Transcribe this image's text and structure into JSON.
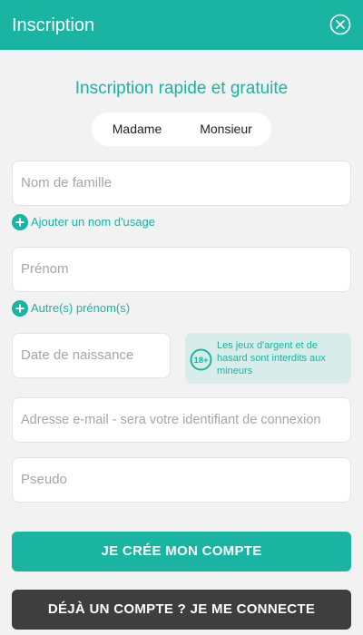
{
  "header": {
    "title": "Inscription",
    "close_icon": "close-circle-icon"
  },
  "form": {
    "subtitle": "Inscription rapide et gratuite",
    "gender": {
      "options": [
        "Madame",
        "Monsieur"
      ]
    },
    "last_name": {
      "placeholder": "Nom de famille",
      "value": ""
    },
    "add_usage_name": {
      "label": "Ajouter un nom d'usage",
      "icon": "plus-circle-icon"
    },
    "first_name": {
      "placeholder": "Prénom",
      "value": ""
    },
    "other_first_names": {
      "label": "Autre(s) prénom(s)",
      "icon": "plus-circle-icon"
    },
    "birth_date": {
      "placeholder": "Date de naissance",
      "value": ""
    },
    "age_notice": {
      "badge": "18+",
      "text": "Les jeux d'argent et de hasard sont interdits aux mineurs"
    },
    "email": {
      "placeholder": "Adresse e-mail - sera votre identifiant de connexion",
      "value": ""
    },
    "pseudo": {
      "placeholder": "Pseudo",
      "value": ""
    }
  },
  "actions": {
    "create_label": "JE CRÉE MON COMPTE",
    "login_label": "DÉJÀ UN COMPTE ? JE ME CONNECTE"
  },
  "colors": {
    "accent": "#1ab4a2",
    "dark_button": "#3e3e3e",
    "background": "#f2f2f2",
    "notice_bg": "#d8ece9"
  }
}
